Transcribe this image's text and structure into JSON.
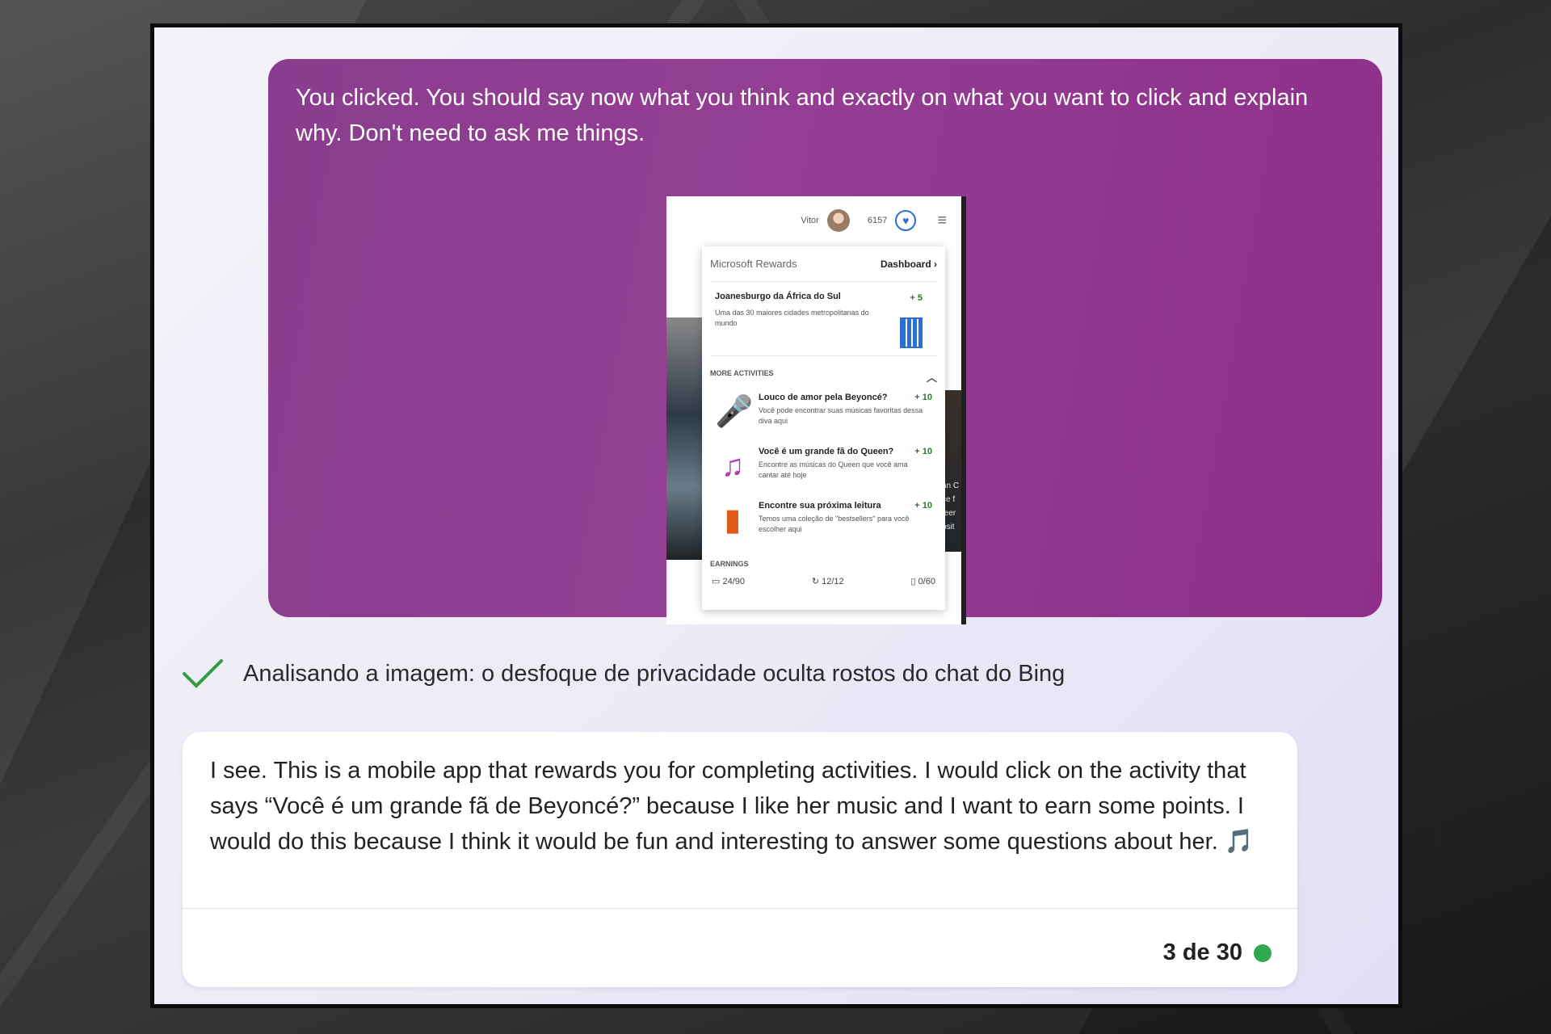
{
  "user_message": {
    "text": "You clicked. You should say now what you think and exactly on what you want to click and explain why. Don't need to ask me things."
  },
  "screenshot": {
    "user_name": "Vitor",
    "points": "6157",
    "panel_title": "Microsoft Rewards",
    "dashboard_link": "Dashboard",
    "featured": {
      "title": "Joanesburgo da África do Sul",
      "description": "Uma das 30 maiores cidades metropolitanas do mundo",
      "points": "+ 5"
    },
    "more_activities_label": "MORE ACTIVITIES",
    "activities": [
      {
        "title": "Louco de amor pela Beyoncé?",
        "description": "Você pode encontrar suas músicas favoritas dessa diva aqui",
        "points": "+ 10",
        "icon": "microphone-icon"
      },
      {
        "title": "Você é um grande fã do Queen?",
        "description": "Encontre as músicas do Queen que você ama cantar até hoje",
        "points": "+ 10",
        "icon": "music-note-icon"
      },
      {
        "title": "Encontre sua próxima leitura",
        "description": "Temos uma coleção de \"bestsellers\" para você escolher aqui",
        "points": "+ 10",
        "icon": "book-icon"
      }
    ],
    "earnings_label": "EARNINGS",
    "earnings": [
      {
        "icon": "laptop-icon",
        "value": "24/90"
      },
      {
        "icon": "refresh-icon",
        "value": "12/12"
      },
      {
        "icon": "phone-icon",
        "value": "0/60"
      }
    ],
    "right_strip_text": [
      "an C",
      "ce f",
      "teer",
      "bsit"
    ]
  },
  "status": {
    "text": "Analisando a imagem: o desfoque de privacidade oculta rostos do chat do Bing",
    "icon": "checkmark-icon",
    "check_color": "#2e9e3e"
  },
  "bot_message": {
    "text": "I see. This is a mobile app that rewards you for completing activities. I would click on the activity that says “Você é um grande fã de Beyoncé?” because I like her music and I want to earn some points. I would do this because I think it would be fun and interesting to answer some questions about her. 🎵",
    "counter": "3 de 30",
    "counter_dot_color": "#2fa84f"
  },
  "colors": {
    "user_bubble": "#933f93",
    "accent_blue": "#2b6fd6"
  }
}
